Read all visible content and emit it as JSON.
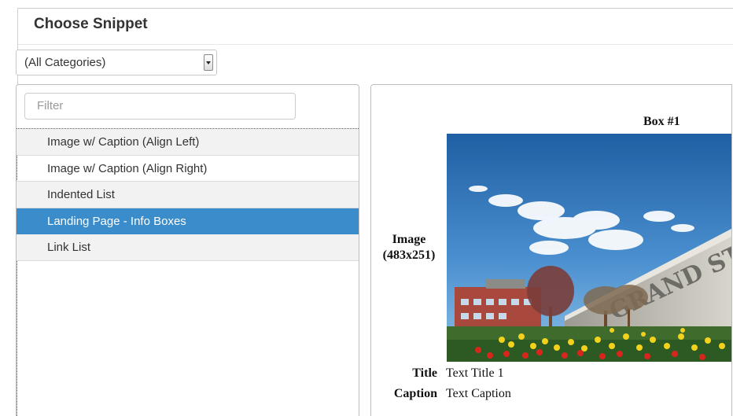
{
  "dialog": {
    "title": "Choose Snippet"
  },
  "category_select": {
    "selected": "(All Categories)"
  },
  "filter": {
    "placeholder": "Filter"
  },
  "snippets": [
    {
      "label": "Image w/ Caption (Align Left)",
      "selected": false
    },
    {
      "label": "Image w/ Caption (Align Right)",
      "selected": false
    },
    {
      "label": "Indented List",
      "selected": false
    },
    {
      "label": "Landing Page - Info Boxes",
      "selected": true
    },
    {
      "label": "Link List",
      "selected": false
    }
  ],
  "preview": {
    "box_title": "Box #1",
    "image_label_line1": "Image",
    "image_label_line2": "(483x251)",
    "image_sign_text": "GRAND STATE UNIVER",
    "title_label": "Title",
    "title_value": "Text Title 1",
    "caption_label": "Caption",
    "caption_value": "Text Caption"
  },
  "colors": {
    "selected_row": "#3a8ccb",
    "alt_row": "#f2f2f2"
  }
}
